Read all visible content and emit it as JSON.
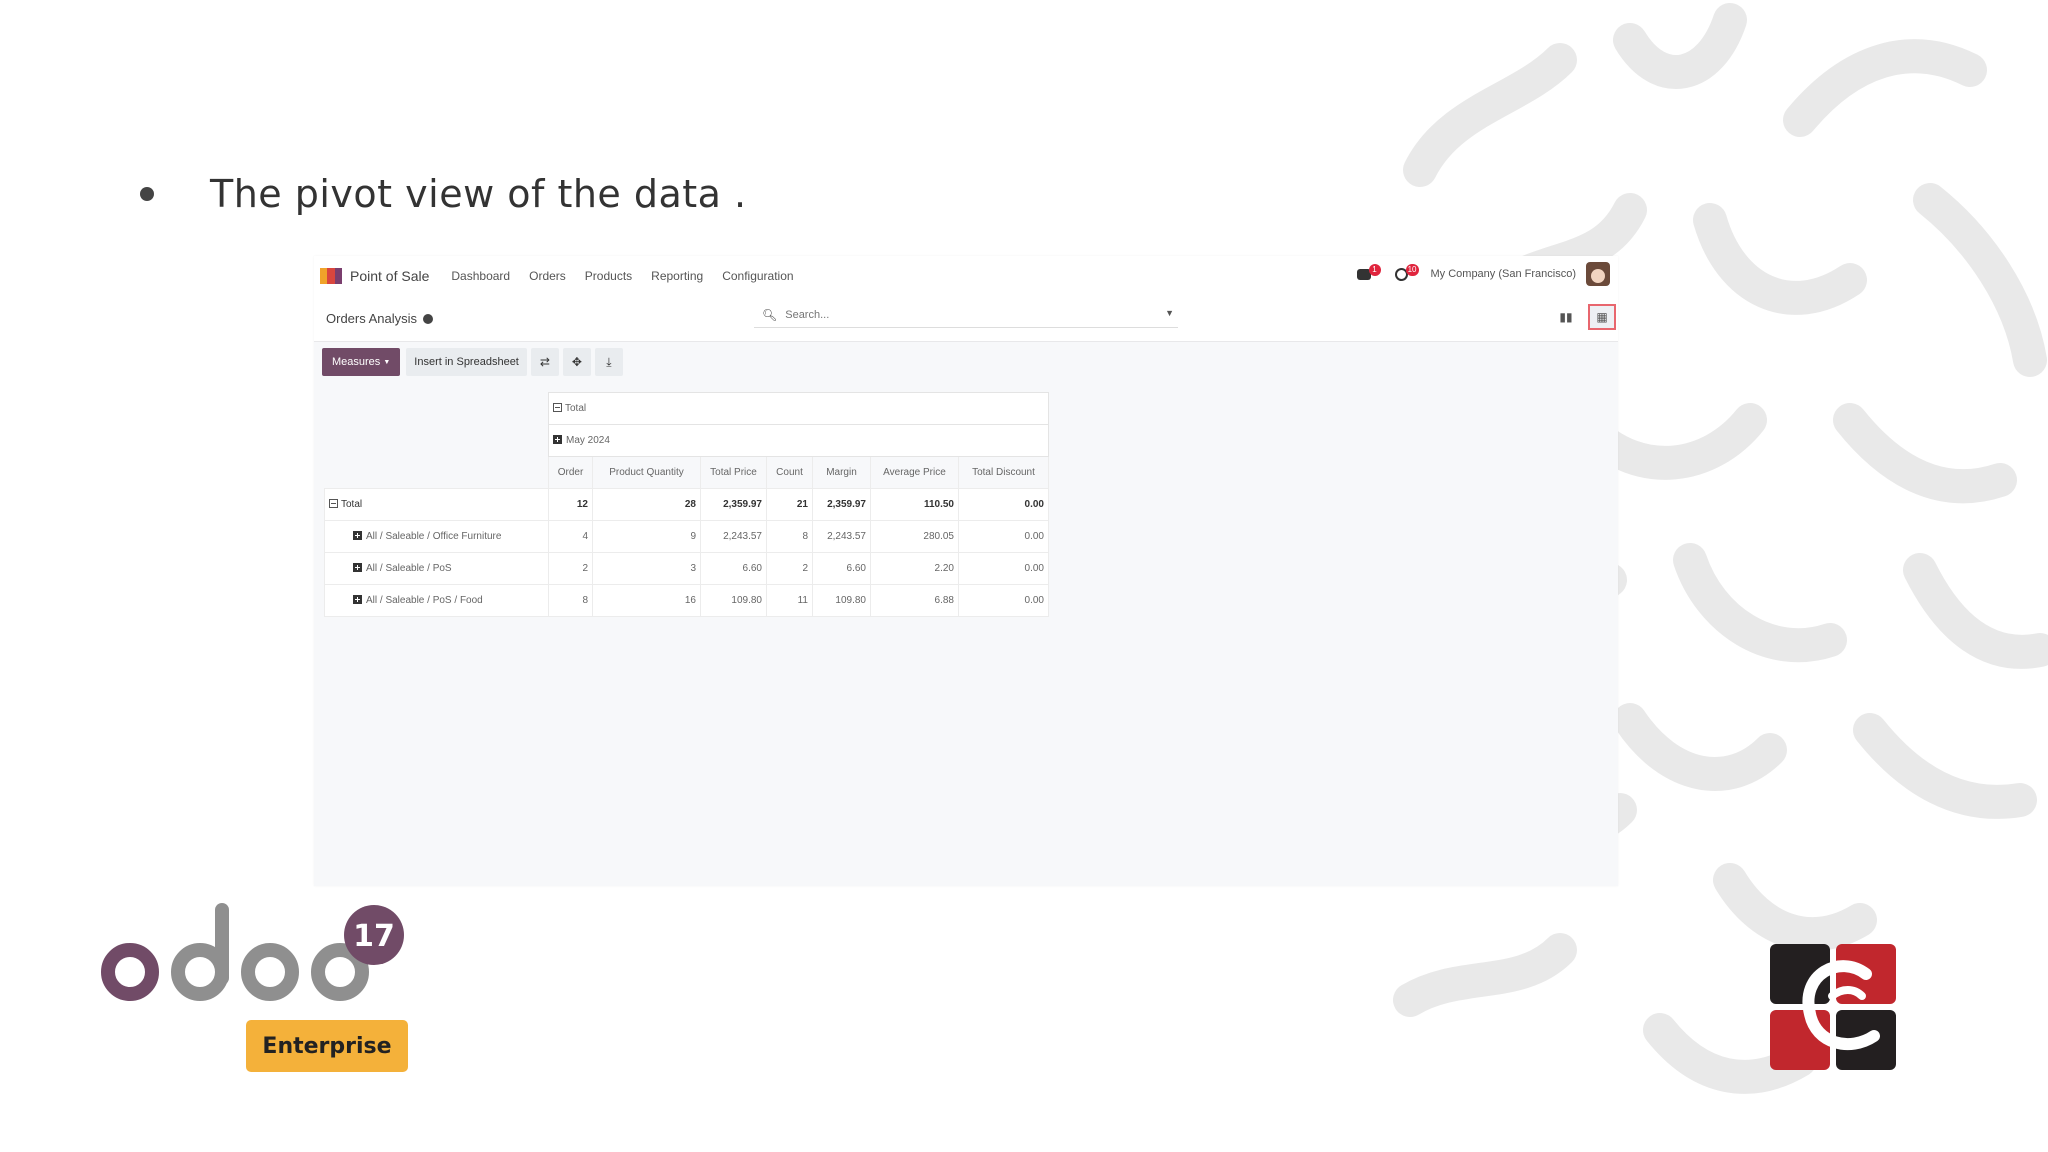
{
  "slide": {
    "bullet_text": "The pivot view of the data ."
  },
  "app": {
    "name": "Point of Sale",
    "menu": [
      "Dashboard",
      "Orders",
      "Products",
      "Reporting",
      "Configuration"
    ],
    "chat_badge": "1",
    "activity_badge": "10",
    "company": "My Company (San Francisco)"
  },
  "control_panel": {
    "breadcrumb": "Orders Analysis",
    "search_placeholder": "Search..."
  },
  "toolbar": {
    "measures_label": "Measures",
    "insert_label": "Insert in Spreadsheet"
  },
  "pivot": {
    "col_total_header": "Total",
    "col_group_header": "May 2024",
    "measures": [
      "Order",
      "Product Quantity",
      "Total Price",
      "Count",
      "Margin",
      "Average Price",
      "Total Discount"
    ],
    "total_row": {
      "label": "Total",
      "values": [
        "12",
        "28",
        "2,359.97",
        "21",
        "2,359.97",
        "110.50",
        "0.00"
      ]
    },
    "rows": [
      {
        "label": "All / Saleable / Office Furniture",
        "values": [
          "4",
          "9",
          "2,243.57",
          "8",
          "2,243.57",
          "280.05",
          "0.00"
        ]
      },
      {
        "label": "All / Saleable / PoS",
        "values": [
          "2",
          "3",
          "6.60",
          "2",
          "6.60",
          "2.20",
          "0.00"
        ]
      },
      {
        "label": "All / Saleable / PoS / Food",
        "values": [
          "8",
          "16",
          "109.80",
          "11",
          "109.80",
          "6.88",
          "0.00"
        ]
      }
    ]
  },
  "branding": {
    "odoo_word": "odoo",
    "odoo_version": "17",
    "edition": "Enterprise"
  },
  "colors": {
    "odoo_purple": "#714b67",
    "odoo_gray": "#8f8f8f",
    "enterprise_orange": "#f4b13a",
    "logo_red": "#c1272d",
    "logo_dark": "#231f20"
  }
}
